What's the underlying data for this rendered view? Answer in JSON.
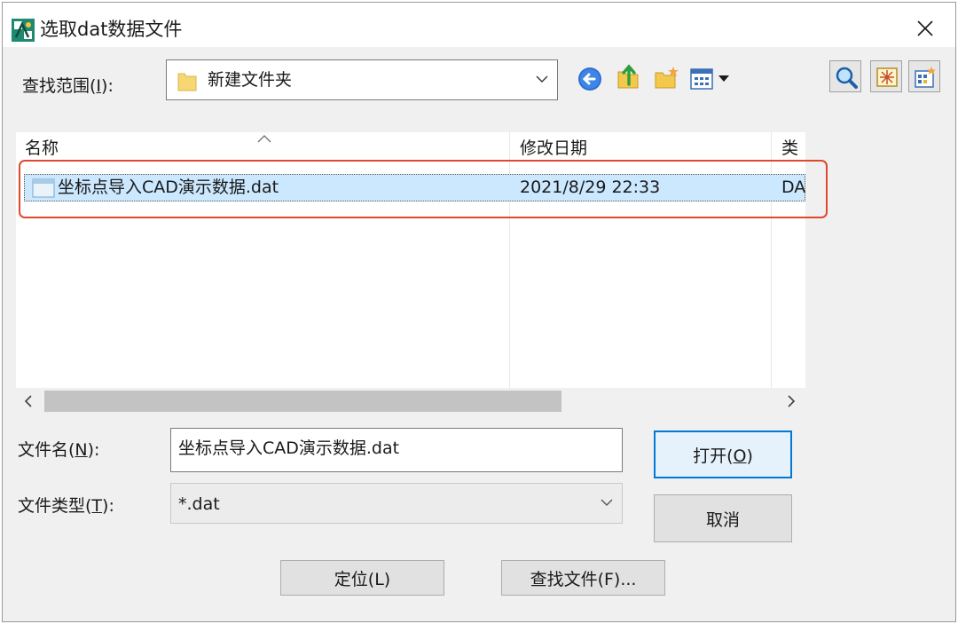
{
  "window": {
    "title": "选取dat数据文件",
    "close_glyph": "✕"
  },
  "lookin": {
    "label_prefix": "查找范围(",
    "label_key": "I",
    "label_suffix": "):",
    "value": "新建文件夹"
  },
  "list": {
    "columns": [
      "名称",
      "修改日期",
      "类"
    ],
    "rows": [
      {
        "name": "坐标点导入CAD演示数据.dat",
        "modified": "2021/8/29 22:33",
        "type": "DA"
      }
    ]
  },
  "filename": {
    "label_prefix": "文件名(",
    "label_key": "N",
    "label_suffix": "):",
    "value": "坐标点导入CAD演示数据.dat"
  },
  "filetype": {
    "label_prefix": "文件类型(",
    "label_key": "T",
    "label_suffix": "):",
    "value": "*.dat"
  },
  "buttons": {
    "open": {
      "prefix": "打开(",
      "key": "O",
      "suffix": ")"
    },
    "cancel": "取消",
    "locate": "定位(L)",
    "find_file": "查找文件(F)..."
  },
  "icons": {
    "app": "app-logo-icon",
    "back": "back-arrow-icon",
    "up": "up-folder-icon",
    "new_folder": "new-folder-icon",
    "views": "view-menu-icon",
    "search": "magnifier-icon",
    "preview": "preview-icon",
    "select_initial": "select-initial-icon"
  },
  "colors": {
    "selection": "#cce8ff",
    "highlight_border": "#e0482e",
    "default_button_border": "#0078d7"
  }
}
